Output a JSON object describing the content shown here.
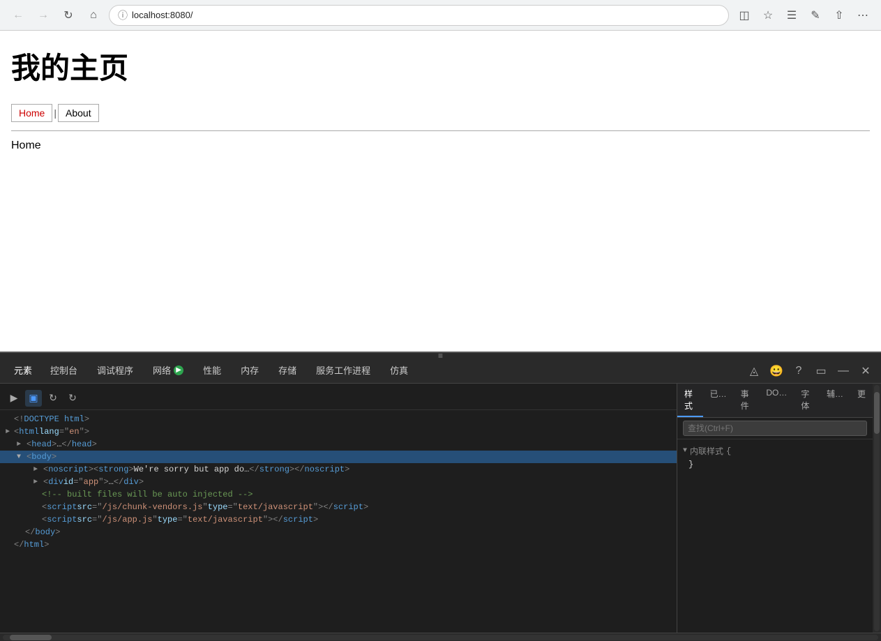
{
  "browser": {
    "url": "localhost:8080/",
    "back_disabled": true,
    "forward_disabled": true
  },
  "page": {
    "title": "我的主页",
    "nav": {
      "home_label": "Home",
      "about_label": "About"
    },
    "current_section": "Home"
  },
  "devtools": {
    "tabs": [
      "元素",
      "控制台",
      "调试程序",
      "网络",
      "性能",
      "内存",
      "存储",
      "服务工作进程",
      "仿真"
    ],
    "active_tab": "元素",
    "toolbar_buttons": [
      "select-element",
      "inspect-box",
      "refresh",
      "rotate"
    ],
    "search_placeholder": "查找(Ctrl+F)",
    "code_lines": [
      {
        "indent": 0,
        "toggle": "",
        "content": "<!DOCTYPE html>",
        "type": "doctype"
      },
      {
        "indent": 0,
        "toggle": "▶",
        "content": "<html lang=\"en\">",
        "type": "tag-open"
      },
      {
        "indent": 1,
        "toggle": "▶",
        "content": "<head>…</head>",
        "type": "tag-collapsed"
      },
      {
        "indent": 1,
        "toggle": "▼",
        "content": "<body>",
        "type": "tag-open",
        "selected": true
      },
      {
        "indent": 2,
        "toggle": "▶",
        "content": "<noscript><strong>We're sorry but app do…</strong></noscript>",
        "type": "tag"
      },
      {
        "indent": 2,
        "toggle": "▶",
        "content": "<div id=\"app\">…</div>",
        "type": "tag"
      },
      {
        "indent": 2,
        "toggle": "",
        "content": "<!-- built files will be auto injected -->",
        "type": "comment"
      },
      {
        "indent": 2,
        "toggle": "",
        "content": "<script src=\"/js/chunk-vendors.js\" type=\"text/javascript\"></script>",
        "type": "tag"
      },
      {
        "indent": 2,
        "toggle": "",
        "content": "<script src=\"/js/app.js\" type=\"text/javascript\"></script>",
        "type": "tag"
      },
      {
        "indent": 1,
        "toggle": "",
        "content": "</body>",
        "type": "tag-close"
      },
      {
        "indent": 0,
        "toggle": "",
        "content": "</html>",
        "type": "tag-close"
      }
    ],
    "styles_tabs": [
      "样式",
      "已…",
      "事件",
      "DO…",
      "字体",
      "辅…",
      "更"
    ],
    "styles_active_tab": "样式",
    "inline_style_label": "内联样式",
    "style_open_brace": "{",
    "style_close_brace": "}"
  }
}
